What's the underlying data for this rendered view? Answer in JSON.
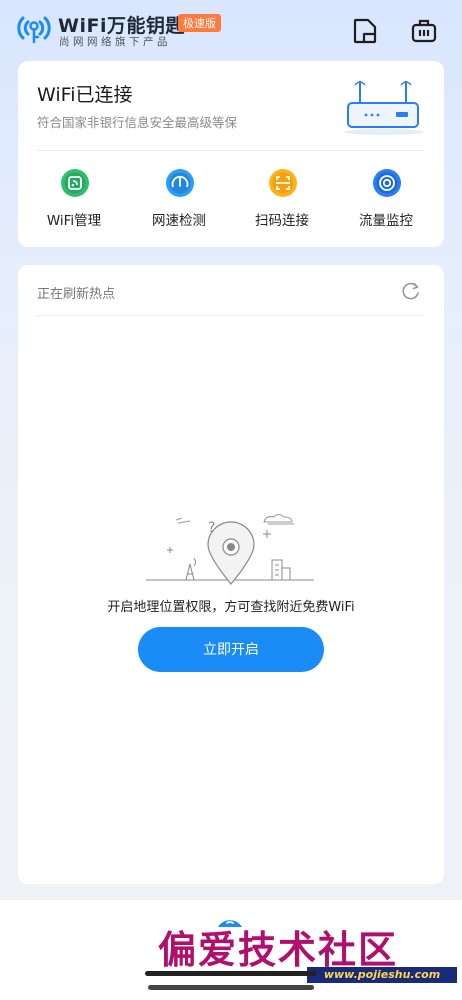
{
  "header": {
    "brand_title": "WiFi万能钥匙",
    "badge": "极速版",
    "subtitle": "尚网网络旗下产品",
    "icons": [
      "wifi-key-logo-icon",
      "document-icon",
      "toolbox-icon"
    ]
  },
  "connection": {
    "title": "WiFi已连接",
    "subtitle": "符合国家非银行信息安全最高级等保",
    "illustration": "router-icon"
  },
  "tools": [
    {
      "label": "WiFi管理",
      "icon": "wifi-manage-icon",
      "color": "#2fbf71"
    },
    {
      "label": "网速检测",
      "icon": "speedometer-icon",
      "color": "#2a9df4"
    },
    {
      "label": "扫码连接",
      "icon": "scan-icon",
      "color": "#ffb21c"
    },
    {
      "label": "流量监控",
      "icon": "traffic-monitor-icon",
      "color": "#2a7df4"
    }
  ],
  "hotspots": {
    "status_text": "正在刷新热点",
    "empty_text": "开启地理位置权限，方可查找附近免费WiFi",
    "button_label": "立即开启"
  },
  "watermark": {
    "title": "偏爱技术社区",
    "url": "www.pojieshu.com"
  },
  "colors": {
    "accent": "#1a8cf5",
    "badge": "#ff7a3d"
  }
}
